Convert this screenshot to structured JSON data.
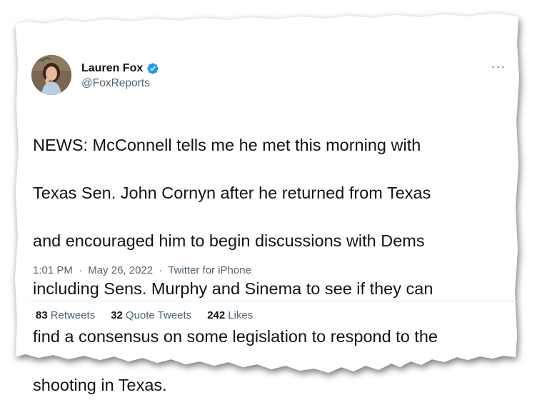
{
  "author": {
    "display_name": "Lauren Fox",
    "handle": "@FoxReports",
    "verified_icon": "verified-badge-icon",
    "avatar_icon": "avatar-photo"
  },
  "tweet": {
    "text_lines": [
      "NEWS: McConnell tells me he met this morning with",
      "Texas Sen. John Cornyn after he returned from Texas",
      "and encouraged him to begin discussions with Dems",
      "including Sens. Murphy and Sinema to see if they can",
      "find a consensus on some legislation to respond to the",
      "shooting in Texas."
    ],
    "time": "1:01 PM",
    "separator": "·",
    "date": "May 26, 2022",
    "source": "Twitter for iPhone"
  },
  "stats": {
    "retweets_count": "83",
    "retweets_label": "Retweets",
    "quotes_count": "32",
    "quotes_label": "Quote Tweets",
    "likes_count": "242",
    "likes_label": "Likes"
  },
  "menu": {
    "more_icon": "more-options-icon",
    "more_glyph": "···"
  },
  "colors": {
    "text_primary": "#0f1419",
    "text_secondary": "#536471",
    "verified_blue": "#1d9bf0",
    "divider": "#e6ecf0"
  }
}
